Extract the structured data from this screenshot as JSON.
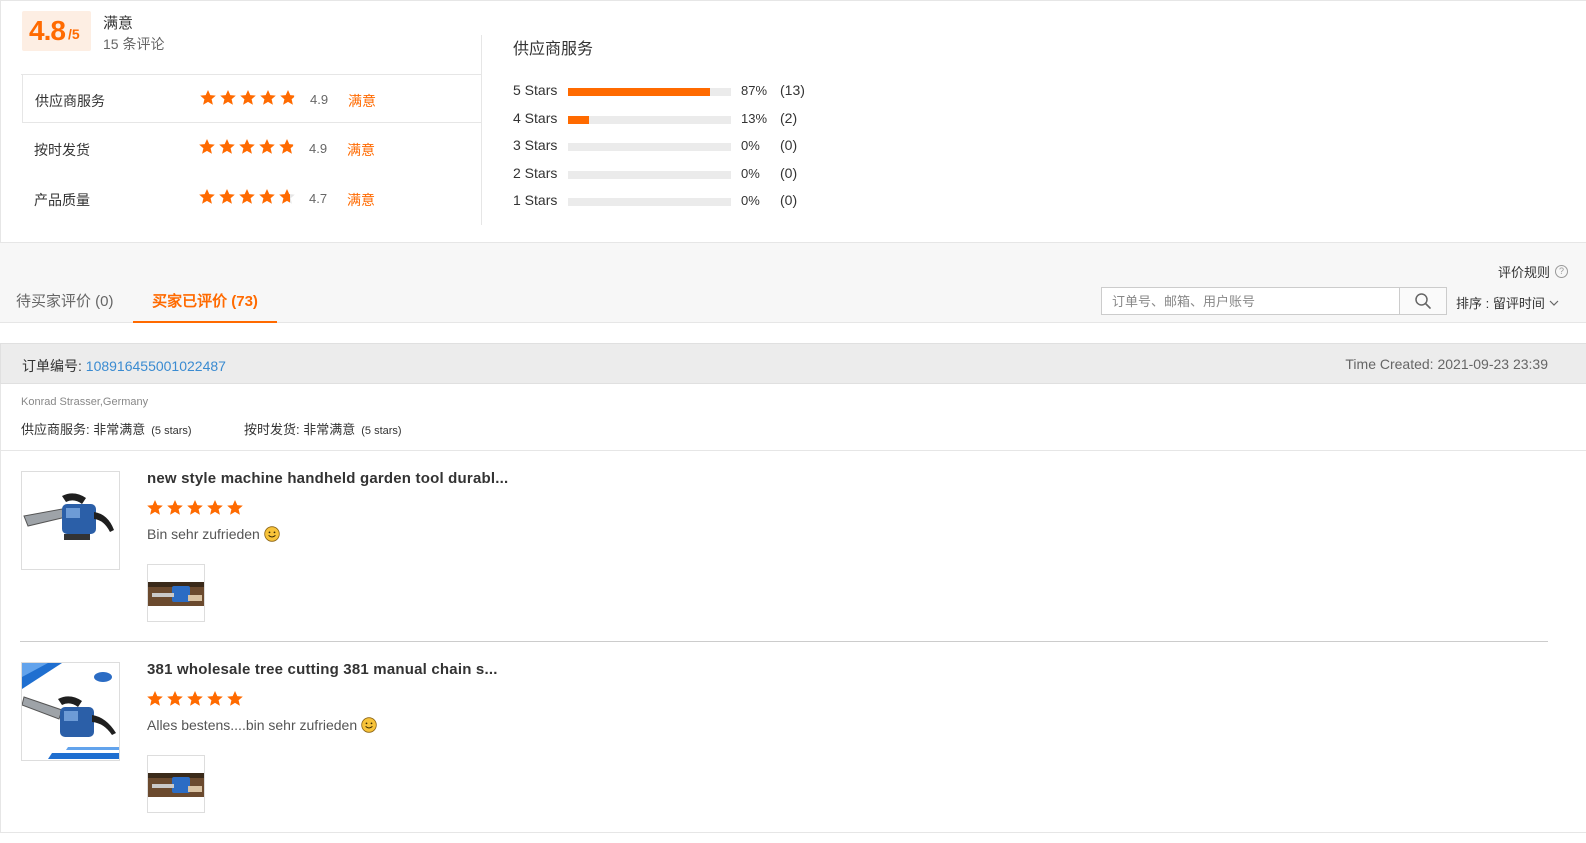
{
  "summary": {
    "score": "4.8",
    "score_max": "/5",
    "overall_level": "满意",
    "review_count": "15 条评论",
    "ratings": [
      {
        "label": "供应商服务",
        "value": "4.9",
        "level": "满意",
        "stars": 4.9
      },
      {
        "label": "按时发货",
        "value": "4.9",
        "level": "满意",
        "stars": 4.9
      },
      {
        "label": "产品质量",
        "value": "4.7",
        "level": "满意",
        "stars": 4.7
      }
    ]
  },
  "distribution": {
    "title": "供应商服务",
    "rows": [
      {
        "label": "5  Stars",
        "percent": 87,
        "pct_text": "87%",
        "count": "(13)"
      },
      {
        "label": "4  Stars",
        "percent": 13,
        "pct_text": "13%",
        "count": "(2)"
      },
      {
        "label": "3  Stars",
        "percent": 0,
        "pct_text": "0%",
        "count": "(0)"
      },
      {
        "label": "2  Stars",
        "percent": 0,
        "pct_text": "0%",
        "count": "(0)"
      },
      {
        "label": "1  Stars",
        "percent": 0,
        "pct_text": "0%",
        "count": "(0)"
      }
    ]
  },
  "toolbar": {
    "rules_label": "评价规则",
    "tab_pending": "待买家评价 (0)",
    "tab_reviewed": "买家已评价 (73)",
    "search_placeholder": "订单号、邮箱、用户账号",
    "sort_label": "排序 : 留评时间"
  },
  "order": {
    "order_label": "订单编号: ",
    "order_number": "108916455001022487",
    "time_created": "Time Created: 2021-09-23 23:39",
    "buyer": "Konrad Strasser,Germany",
    "supplier_service_label": "供应商服务: ",
    "supplier_service_value": "非常满意",
    "supplier_service_stars": "(5 stars)",
    "shipping_label": "按时发货: ",
    "shipping_value": "非常满意",
    "shipping_stars": "(5 stars)"
  },
  "products": [
    {
      "title": "new style machine handheld garden tool durabl...",
      "stars": 5,
      "comment": "Bin sehr zufrieden"
    },
    {
      "title": "381 wholesale tree cutting 381 manual chain s...",
      "stars": 5,
      "comment": "Alles bestens....bin sehr zufrieden"
    }
  ],
  "colors": {
    "accent": "#ff6a00",
    "link": "#3a8bd1",
    "track": "#ebebeb"
  }
}
